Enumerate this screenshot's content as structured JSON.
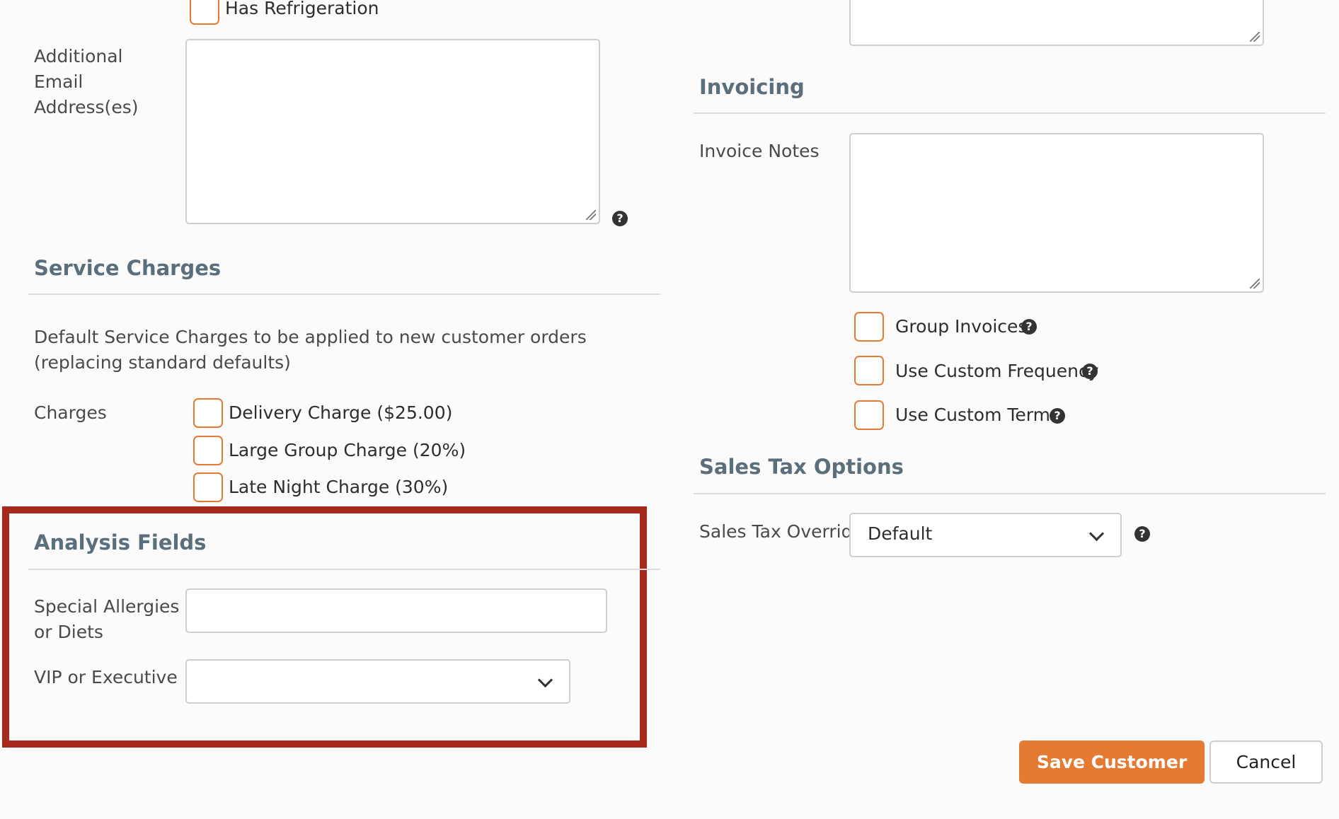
{
  "left": {
    "has_refrigeration_label": "Has Refrigeration",
    "additional_email_label": "Additional Email Address(es)",
    "additional_email_value": "",
    "service_charges": {
      "title": "Service Charges",
      "description": "Default Service Charges to be applied to new customer orders (replacing standard defaults)",
      "charges_label": "Charges",
      "items": [
        {
          "label": "Delivery Charge ($25.00)",
          "checked": false
        },
        {
          "label": "Large Group Charge (20%)",
          "checked": false
        },
        {
          "label": "Late Night Charge (30%)",
          "checked": false
        }
      ]
    },
    "analysis_fields": {
      "title": "Analysis Fields",
      "allergies_label": "Special Allergies or Diets",
      "allergies_value": "",
      "vip_label": "VIP or Executive",
      "vip_value": ""
    }
  },
  "right": {
    "invoicing": {
      "title": "Invoicing",
      "invoice_notes_label": "Invoice Notes",
      "invoice_notes_value": "",
      "options": [
        {
          "label": "Group Invoices",
          "checked": false
        },
        {
          "label": "Use Custom Frequency",
          "checked": false
        },
        {
          "label": "Use Custom Terms",
          "checked": false
        }
      ]
    },
    "sales_tax": {
      "title": "Sales Tax Options",
      "override_label": "Sales Tax Override",
      "override_value": "Default"
    }
  },
  "actions": {
    "save_label": "Save Customer",
    "cancel_label": "Cancel"
  },
  "icons": {
    "help": "question-circle-icon",
    "dropdown": "chevron-down-icon"
  },
  "colors": {
    "accent": "#e57a33",
    "section_title": "#5b6e7c",
    "highlight_border": "#a7281c"
  }
}
